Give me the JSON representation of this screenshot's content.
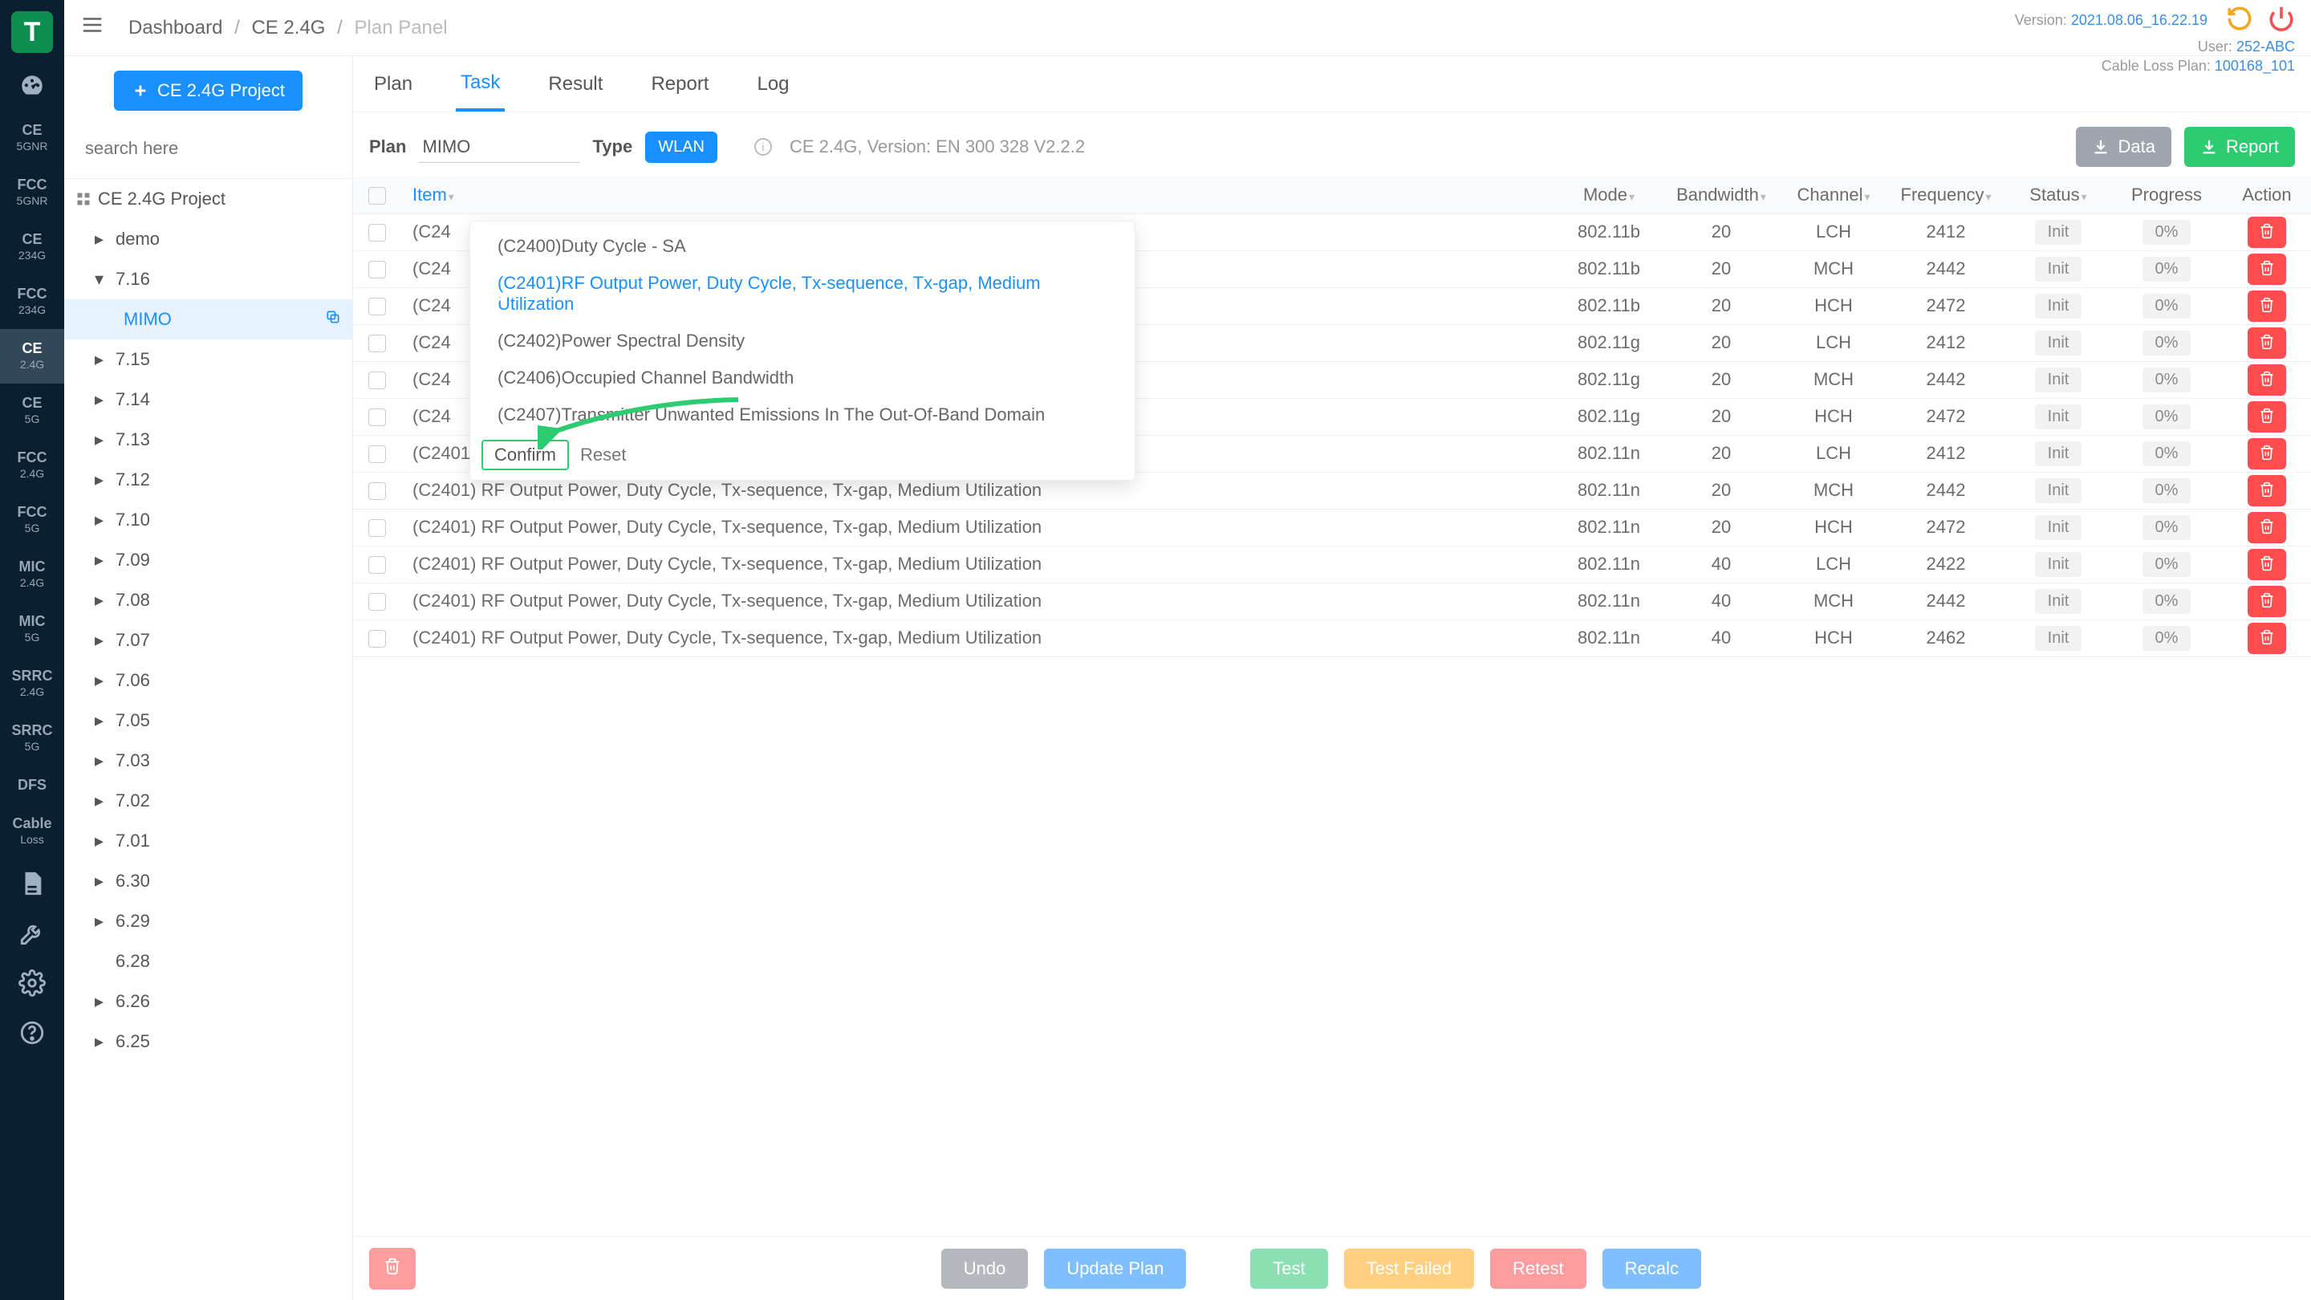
{
  "breadcrumb": {
    "a": "Dashboard",
    "b": "CE 2.4G",
    "c": "Plan Panel"
  },
  "meta": {
    "version_label": "Version:",
    "version_value": "2021.08.06_16.22.19",
    "user_label": "User:",
    "user_value": "252-ABC",
    "plan_label": "Cable Loss Plan:",
    "plan_value": "100168_101"
  },
  "rail": [
    {
      "k": "dashboard",
      "icon": "gauge"
    },
    {
      "k": "ce-5gnr",
      "t": "CE",
      "s": "5GNR"
    },
    {
      "k": "fcc-5gnr",
      "t": "FCC",
      "s": "5GNR"
    },
    {
      "k": "ce-234g",
      "t": "CE",
      "s": "234G"
    },
    {
      "k": "fcc-234g",
      "t": "FCC",
      "s": "234G"
    },
    {
      "k": "ce-24g",
      "t": "CE",
      "s": "2.4G",
      "active": true
    },
    {
      "k": "ce-5g",
      "t": "CE",
      "s": "5G"
    },
    {
      "k": "fcc-24g",
      "t": "FCC",
      "s": "2.4G"
    },
    {
      "k": "fcc-5g",
      "t": "FCC",
      "s": "5G"
    },
    {
      "k": "mic-24g",
      "t": "MIC",
      "s": "2.4G"
    },
    {
      "k": "mic-5g",
      "t": "MIC",
      "s": "5G"
    },
    {
      "k": "srrc-24g",
      "t": "SRRC",
      "s": "2.4G"
    },
    {
      "k": "srrc-5g",
      "t": "SRRC",
      "s": "5G"
    },
    {
      "k": "dfs",
      "t": "DFS"
    },
    {
      "k": "cableloss",
      "t": "Cable",
      "s": "Loss"
    },
    {
      "k": "doc",
      "icon": "doc"
    },
    {
      "k": "wrench",
      "icon": "wrench"
    },
    {
      "k": "gear",
      "icon": "gear"
    },
    {
      "k": "help",
      "icon": "help"
    }
  ],
  "sidebar": {
    "new_project_label": "CE 2.4G Project",
    "search_placeholder": "search here",
    "root_label": "CE 2.4G Project",
    "demo_label": "demo",
    "active_node": "7.16",
    "active_leaf": "MIMO",
    "nodes": [
      "7.15",
      "7.14",
      "7.13",
      "7.12",
      "7.10",
      "7.09",
      "7.08",
      "7.07",
      "7.06",
      "7.05",
      "7.03",
      "7.02",
      "7.01",
      "6.30",
      "6.29",
      "6.28",
      "6.26",
      "6.25"
    ]
  },
  "tabs": {
    "plan": "Plan",
    "task": "Task",
    "result": "Result",
    "report": "Report",
    "log": "Log"
  },
  "plan_row": {
    "plan_label": "Plan",
    "plan_value": "MIMO",
    "type_label": "Type",
    "type_value": "WLAN",
    "version_text": "CE 2.4G, Version: EN 300 328 V2.2.2",
    "data_btn": "Data",
    "report_btn": "Report"
  },
  "table": {
    "headers": {
      "item": "Item",
      "mode": "Mode",
      "bw": "Bandwidth",
      "ch": "Channel",
      "freq": "Frequency",
      "status": "Status",
      "progress": "Progress",
      "action": "Action"
    },
    "item_text_full": "(C2401) RF Output Power, Duty Cycle, Tx-sequence, Tx-gap, Medium Utilization",
    "item_text_cut": "(C24",
    "status_init": "Init",
    "progress_zero": "0%",
    "rows": [
      {
        "cut": true,
        "mode": "802.11b",
        "bw": "20",
        "ch": "LCH",
        "freq": "2412"
      },
      {
        "cut": true,
        "mode": "802.11b",
        "bw": "20",
        "ch": "MCH",
        "freq": "2442"
      },
      {
        "cut": true,
        "mode": "802.11b",
        "bw": "20",
        "ch": "HCH",
        "freq": "2472"
      },
      {
        "cut": true,
        "mode": "802.11g",
        "bw": "20",
        "ch": "LCH",
        "freq": "2412"
      },
      {
        "cut": true,
        "mode": "802.11g",
        "bw": "20",
        "ch": "MCH",
        "freq": "2442"
      },
      {
        "cut": true,
        "mode": "802.11g",
        "bw": "20",
        "ch": "HCH",
        "freq": "2472"
      },
      {
        "cut": false,
        "mode": "802.11n",
        "bw": "20",
        "ch": "LCH",
        "freq": "2412"
      },
      {
        "cut": false,
        "mode": "802.11n",
        "bw": "20",
        "ch": "MCH",
        "freq": "2442"
      },
      {
        "cut": false,
        "mode": "802.11n",
        "bw": "20",
        "ch": "HCH",
        "freq": "2472"
      },
      {
        "cut": false,
        "mode": "802.11n",
        "bw": "40",
        "ch": "LCH",
        "freq": "2422"
      },
      {
        "cut": false,
        "mode": "802.11n",
        "bw": "40",
        "ch": "MCH",
        "freq": "2442"
      },
      {
        "cut": false,
        "mode": "802.11n",
        "bw": "40",
        "ch": "HCH",
        "freq": "2462"
      }
    ]
  },
  "popover": {
    "items": [
      {
        "label": "(C2400)Duty Cycle - SA",
        "sel": false
      },
      {
        "label": "(C2401)RF Output Power, Duty Cycle, Tx-sequence, Tx-gap, Medium Utilization",
        "sel": true
      },
      {
        "label": "(C2402)Power Spectral Density",
        "sel": false
      },
      {
        "label": "(C2406)Occupied Channel Bandwidth",
        "sel": false
      },
      {
        "label": "(C2407)Transmitter Unwanted Emissions In The Out-Of-Band Domain",
        "sel": false
      }
    ],
    "confirm": "Confirm",
    "reset": "Reset"
  },
  "bottom": {
    "undo": "Undo",
    "update": "Update Plan",
    "test": "Test",
    "failed": "Test Failed",
    "retest": "Retest",
    "recalc": "Recalc"
  }
}
